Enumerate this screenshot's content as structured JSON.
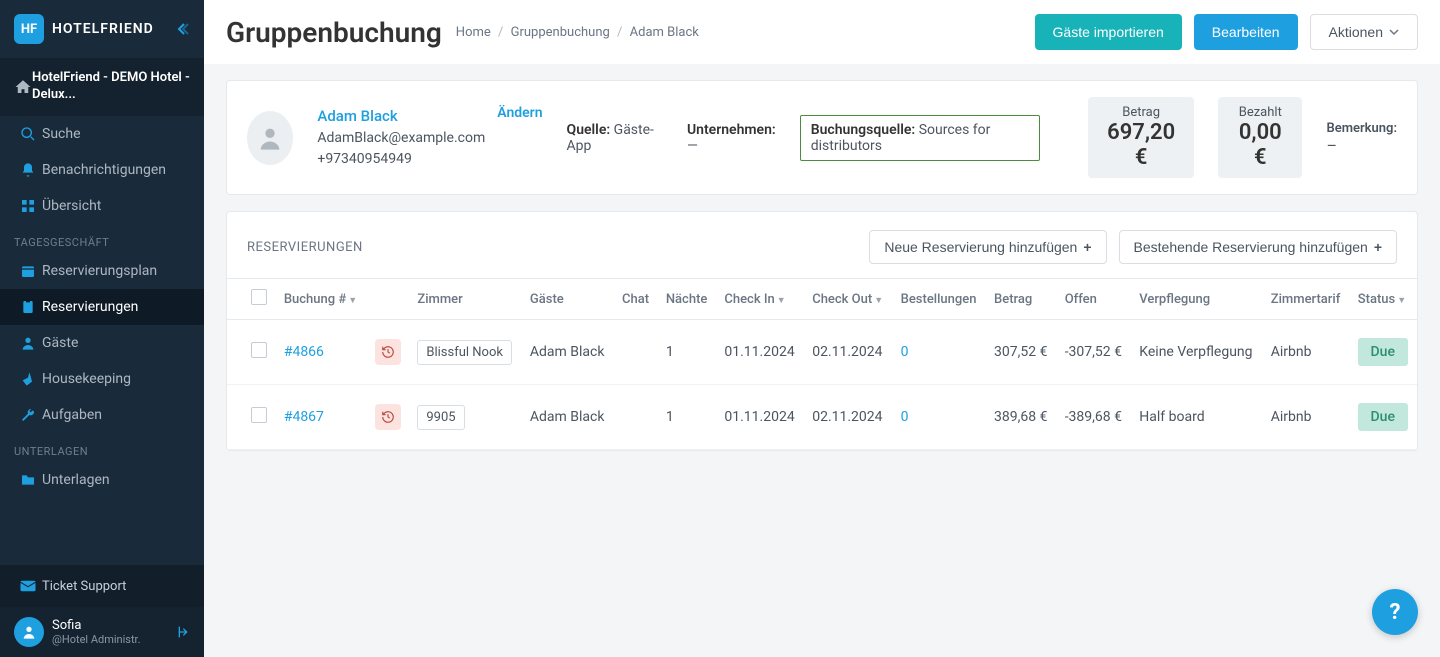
{
  "brand": "HOTELFRIEND",
  "hotel": {
    "name": "HotelFriend - DEMO Hotel - Delux..."
  },
  "nav": {
    "search": "Suche",
    "notif": "Benachrichtigungen",
    "overview": "Übersicht",
    "section_daily": "TAGESGESCHÄFT",
    "resplan": "Reservierungsplan",
    "reservations": "Reservierungen",
    "guests": "Gäste",
    "housekeeping": "Housekeeping",
    "tasks": "Aufgaben",
    "section_docs": "UNTERLAGEN",
    "docs": "Unterlagen",
    "ticket": "Ticket Support"
  },
  "user": {
    "name": "Sofia",
    "role": "@Hotel Administr."
  },
  "page": {
    "title": "Gruppenbuchung",
    "breadcrumb": {
      "home": "Home",
      "mid": "Gruppenbuchung",
      "leaf": "Adam Black"
    }
  },
  "actions": {
    "import": "Gäste importieren",
    "edit": "Bearbeiten",
    "menu": "Aktionen"
  },
  "guest": {
    "name": "Adam Black",
    "email": "AdamBlack@example.com",
    "phone": "+97340954949",
    "change": "Ändern",
    "source_label": "Quelle:",
    "source_value": "Gäste-App",
    "company_label": "Unternehmen:",
    "company_value": "—",
    "booking_source_label": "Buchungsquelle:",
    "booking_source_value": "Sources for distributors"
  },
  "money": {
    "amount_label": "Betrag",
    "amount_value": "697,20 €",
    "paid_label": "Bezahlt",
    "paid_value": "0,00 €",
    "remark_label": "Bemerkung:",
    "remark_value": "–"
  },
  "res": {
    "title": "RESERVIERUNGEN",
    "new": "Neue Reservierung hinzufügen",
    "existing": "Bestehende Reservierung hinzufügen"
  },
  "table": {
    "cols": {
      "booking": "Buchung #",
      "room": "Zimmer",
      "guests": "Gäste",
      "chat": "Chat",
      "nights": "Nächte",
      "checkin": "Check In",
      "checkout": "Check Out",
      "orders": "Bestellungen",
      "amount": "Betrag",
      "open": "Offen",
      "meal": "Verpflegung",
      "rate": "Zimmertarif",
      "status": "Status"
    },
    "rows": [
      {
        "booking": "#4866",
        "room": "Blissful Nook",
        "guest": "Adam Black",
        "nights": "1",
        "checkin": "01.11.2024",
        "checkout": "02.11.2024",
        "orders": "0",
        "amount": "307,52 €",
        "open": "-307,52 €",
        "meal": "Keine Verpflegung",
        "rate": "Airbnb",
        "status": "Due"
      },
      {
        "booking": "#4867",
        "room": "9905",
        "guest": "Adam Black",
        "nights": "1",
        "checkin": "01.11.2024",
        "checkout": "02.11.2024",
        "orders": "0",
        "amount": "389,68 €",
        "open": "-389,68 €",
        "meal": "Half board",
        "rate": "Airbnb",
        "status": "Due"
      }
    ]
  },
  "help": "?"
}
